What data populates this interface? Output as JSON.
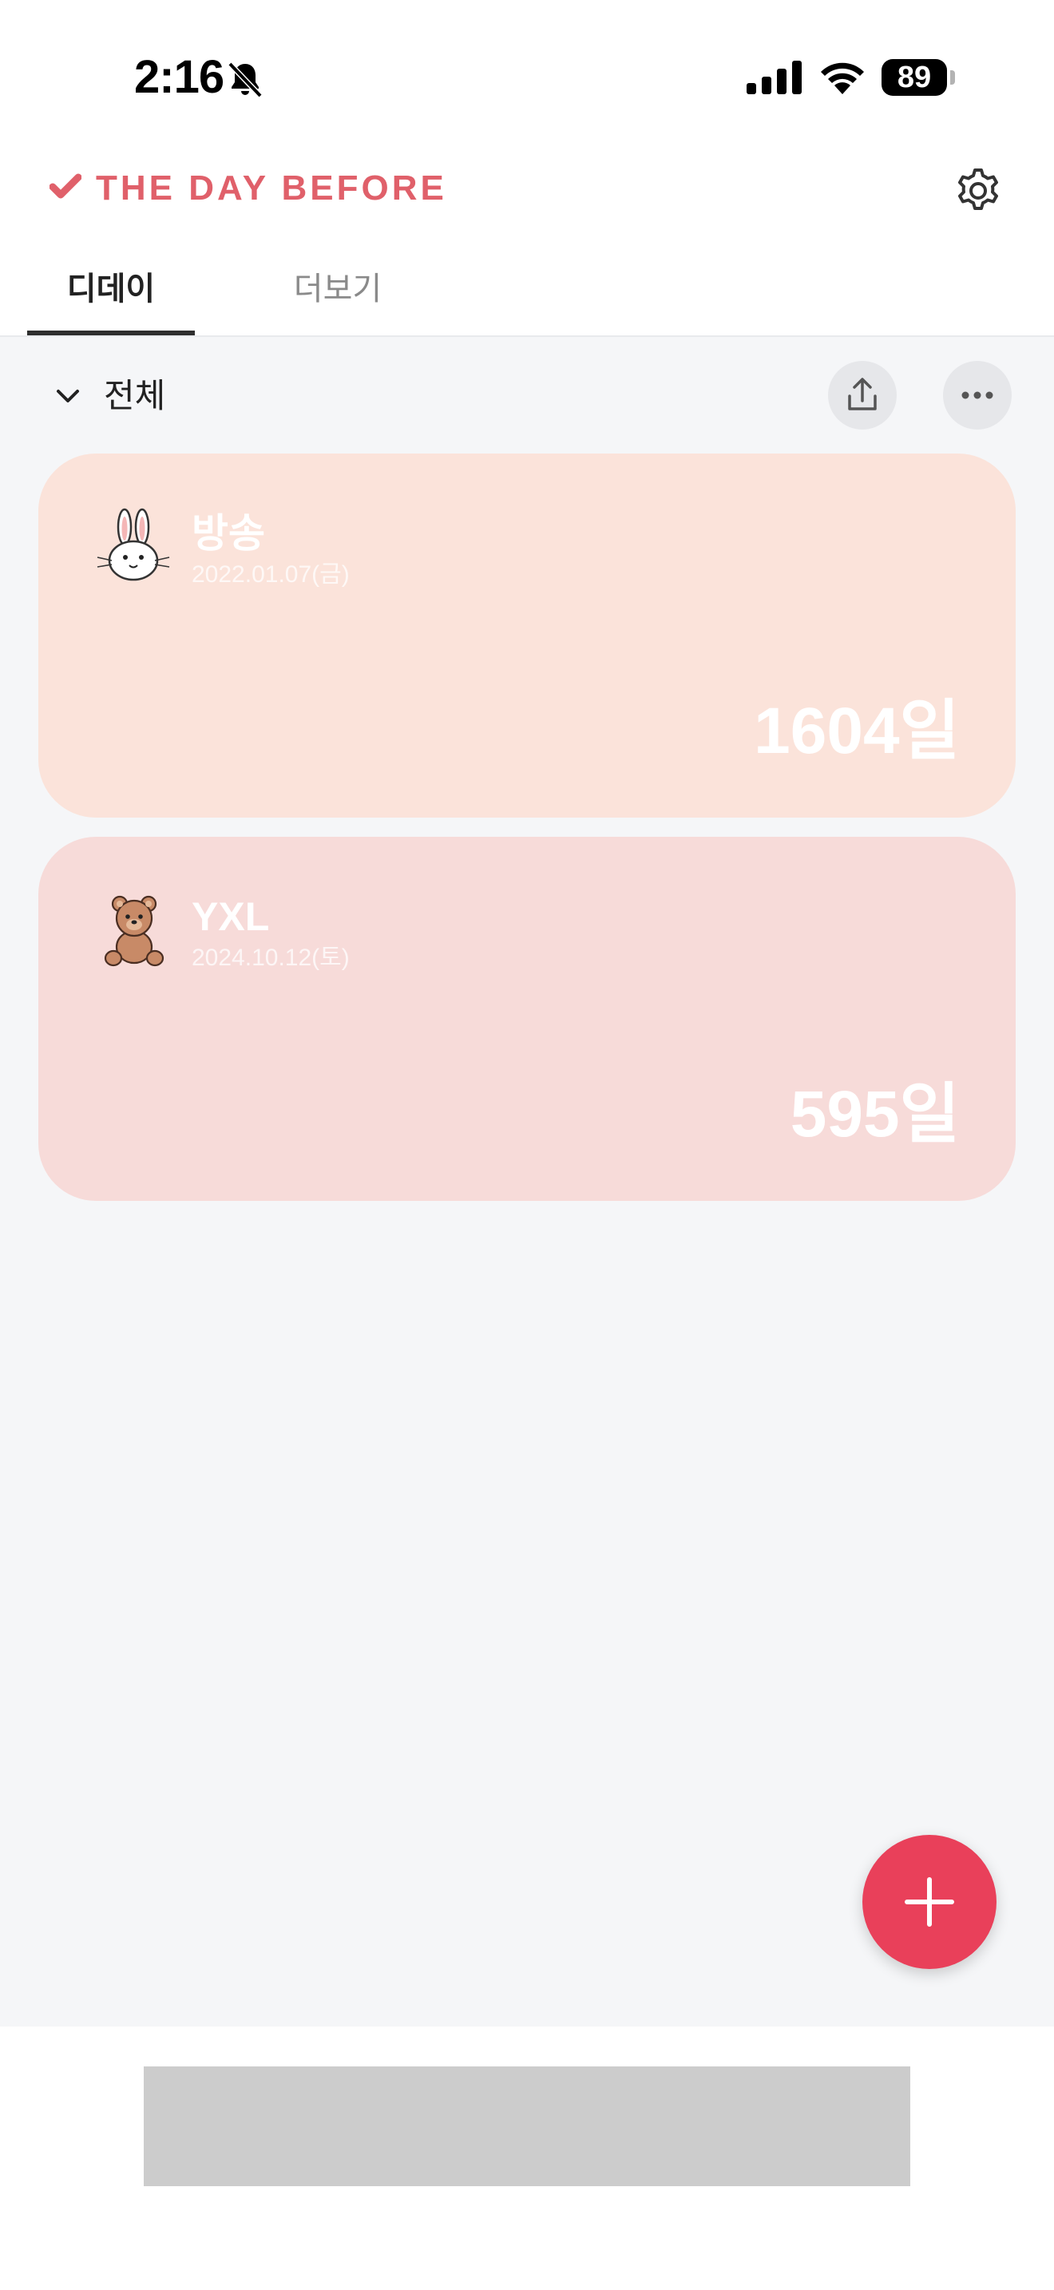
{
  "status_bar": {
    "time": "2:16",
    "battery": "89",
    "icons": [
      "bell-off-icon",
      "cellular-signal-icon",
      "wifi-icon",
      "battery-icon"
    ]
  },
  "header": {
    "logo_text": "THE DAY BEFORE",
    "logo_icon": "heart-check-icon",
    "settings_icon": "gear-icon",
    "brand_color": "#e0606a"
  },
  "tabs": [
    {
      "label": "디데이",
      "active": true
    },
    {
      "label": "더보기",
      "active": false
    }
  ],
  "filter": {
    "label": "전체",
    "share_icon": "share-upload-icon",
    "more_icon": "more-dots-icon"
  },
  "cards": [
    {
      "title": "방송",
      "date": "2022.01.07(금)",
      "count": "1604일",
      "icon": "rabbit-icon",
      "color": "#fbe3da"
    },
    {
      "title": "YXL",
      "date": "2024.10.12(토)",
      "count": "595일",
      "icon": "teddy-bear-icon",
      "color": "#f7dbd9"
    }
  ],
  "fab": {
    "icon": "plus-icon",
    "color": "#e9405a"
  }
}
